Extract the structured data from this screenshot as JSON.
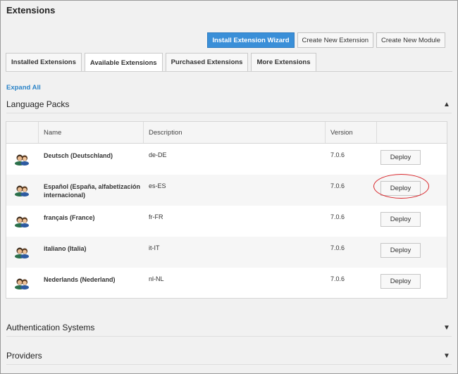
{
  "header": {
    "title": "Extensions"
  },
  "toolbar": {
    "install_wizard": "Install Extension Wizard",
    "create_extension": "Create New Extension",
    "create_module": "Create New Module"
  },
  "tabs": [
    {
      "label": "Installed Extensions",
      "active": false
    },
    {
      "label": "Available Extensions",
      "active": true
    },
    {
      "label": "Purchased Extensions",
      "active": false
    },
    {
      "label": "More Extensions",
      "active": false
    }
  ],
  "expand_all": "Expand All",
  "sections": {
    "language_packs": "Language Packs",
    "authentication": "Authentication Systems",
    "providers": "Providers"
  },
  "table": {
    "columns": [
      "",
      "Name",
      "Description",
      "Version",
      ""
    ],
    "rows": [
      {
        "name": "Deutsch (Deutschland)",
        "description": "de-DE",
        "version": "7.0.6",
        "action": "Deploy",
        "icon": "language-pack-icon"
      },
      {
        "name": "Español (España, alfabetización internacional)",
        "description": "es-ES",
        "version": "7.0.6",
        "action": "Deploy",
        "icon": "language-pack-icon",
        "highlighted": true
      },
      {
        "name": "français (France)",
        "description": "fr-FR",
        "version": "7.0.6",
        "action": "Deploy",
        "icon": "language-pack-icon"
      },
      {
        "name": "italiano (Italia)",
        "description": "it-IT",
        "version": "7.0.6",
        "action": "Deploy",
        "icon": "language-pack-icon"
      },
      {
        "name": "Nederlands (Nederland)",
        "description": "nl-NL",
        "version": "7.0.6",
        "action": "Deploy",
        "icon": "language-pack-icon"
      }
    ]
  },
  "colors": {
    "primary": "#3a8fd8",
    "link": "#2b84c8",
    "highlight": "#d9262b"
  }
}
